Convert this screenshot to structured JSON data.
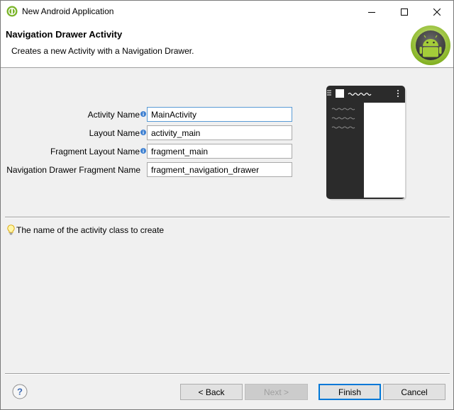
{
  "window": {
    "title": "New Android Application",
    "controls": {
      "minimize": "minimize-icon",
      "maximize": "maximize-icon",
      "close": "close-icon"
    }
  },
  "banner": {
    "title": "Navigation Drawer Activity",
    "description": "Creates a new Activity with a Navigation Drawer.",
    "logo_icon": "android-logo-icon"
  },
  "form": {
    "fields": [
      {
        "label": "Activity Name",
        "value": "MainActivity",
        "has_info": true,
        "focused": true
      },
      {
        "label": "Layout Name",
        "value": "activity_main",
        "has_info": true,
        "focused": false
      },
      {
        "label": "Fragment Layout Name",
        "value": "fragment_main",
        "has_info": true,
        "focused": false
      },
      {
        "label": "Navigation Drawer Fragment Name",
        "value": "fragment_navigation_drawer",
        "has_info": false,
        "focused": false
      }
    ]
  },
  "hint": {
    "icon": "lightbulb-icon",
    "text": "The name of the activity class to create"
  },
  "buttons": {
    "back": "< Back",
    "next": "Next >",
    "finish": "Finish",
    "cancel": "Cancel",
    "next_enabled": false,
    "default": "finish"
  },
  "colors": {
    "accent": "#0078d7",
    "android_green": "#8fbf21",
    "preview_dark": "#2b2b2b"
  }
}
